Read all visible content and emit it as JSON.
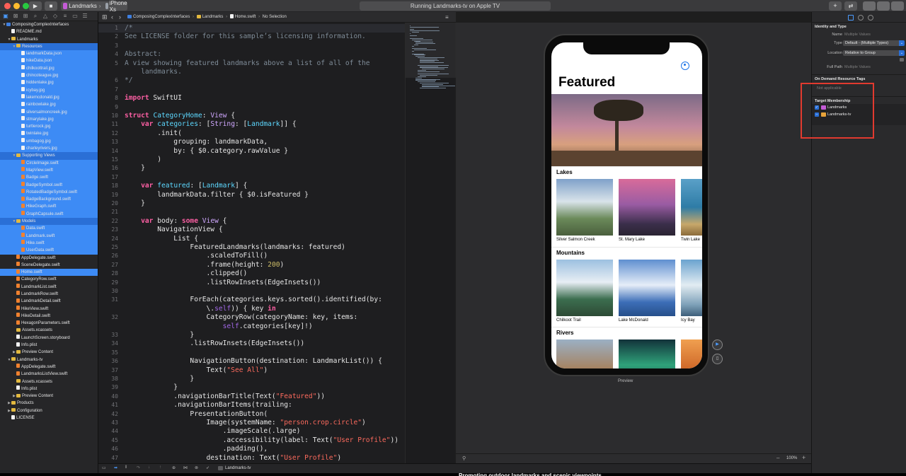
{
  "window": {
    "scheme_target": "Landmarks",
    "scheme_device": "iPhone Xs",
    "activity_status": "Running Landmarks-tv on Apple TV"
  },
  "navigator": {
    "rows": [
      {
        "label": "ComposingComplexInterfaces",
        "indent": 0,
        "kind": "proj",
        "disclosure": "▼",
        "state": "normal"
      },
      {
        "label": "README.md",
        "indent": 1,
        "kind": "file",
        "disclosure": "",
        "state": "normal"
      },
      {
        "label": "Landmarks",
        "indent": 1,
        "kind": "folder",
        "disclosure": "▼",
        "state": "normal"
      },
      {
        "label": "Resources",
        "indent": 2,
        "kind": "folder",
        "disclosure": "▼",
        "state": "sel"
      },
      {
        "label": "landmarkData.json",
        "indent": 3,
        "kind": "file",
        "disclosure": "",
        "state": "sel-light"
      },
      {
        "label": "hikeData.json",
        "indent": 3,
        "kind": "file",
        "disclosure": "",
        "state": "sel-light"
      },
      {
        "label": "chilkoottrail.jpg",
        "indent": 3,
        "kind": "file",
        "disclosure": "",
        "state": "sel-light"
      },
      {
        "label": "chincoteague.jpg",
        "indent": 3,
        "kind": "file",
        "disclosure": "",
        "state": "sel-light"
      },
      {
        "label": "hiddenlake.jpg",
        "indent": 3,
        "kind": "file",
        "disclosure": "",
        "state": "sel-light"
      },
      {
        "label": "icybay.jpg",
        "indent": 3,
        "kind": "file",
        "disclosure": "",
        "state": "sel-light"
      },
      {
        "label": "lakemcdonald.jpg",
        "indent": 3,
        "kind": "file",
        "disclosure": "",
        "state": "sel-light"
      },
      {
        "label": "rainbowlake.jpg",
        "indent": 3,
        "kind": "file",
        "disclosure": "",
        "state": "sel-light"
      },
      {
        "label": "silversalmoncreek.jpg",
        "indent": 3,
        "kind": "file",
        "disclosure": "",
        "state": "sel-light"
      },
      {
        "label": "stmarylake.jpg",
        "indent": 3,
        "kind": "file",
        "disclosure": "",
        "state": "sel-light"
      },
      {
        "label": "turtlerock.jpg",
        "indent": 3,
        "kind": "file",
        "disclosure": "",
        "state": "sel-light"
      },
      {
        "label": "twinlake.jpg",
        "indent": 3,
        "kind": "file",
        "disclosure": "",
        "state": "sel-light"
      },
      {
        "label": "umbagog.jpg",
        "indent": 3,
        "kind": "file",
        "disclosure": "",
        "state": "sel-light"
      },
      {
        "label": "charleyrivers.jpg",
        "indent": 3,
        "kind": "file",
        "disclosure": "",
        "state": "sel-light"
      },
      {
        "label": "Supporting Views",
        "indent": 2,
        "kind": "folder",
        "disclosure": "▼",
        "state": "sel"
      },
      {
        "label": "CircleImage.swift",
        "indent": 3,
        "kind": "swift",
        "disclosure": "",
        "state": "sel-light"
      },
      {
        "label": "MapView.swift",
        "indent": 3,
        "kind": "swift",
        "disclosure": "",
        "state": "sel-light"
      },
      {
        "label": "Badge.swift",
        "indent": 3,
        "kind": "swift",
        "disclosure": "",
        "state": "sel-light"
      },
      {
        "label": "BadgeSymbol.swift",
        "indent": 3,
        "kind": "swift",
        "disclosure": "",
        "state": "sel-light"
      },
      {
        "label": "RotatedBadgeSymbol.swift",
        "indent": 3,
        "kind": "swift",
        "disclosure": "",
        "state": "sel-light"
      },
      {
        "label": "BadgeBackground.swift",
        "indent": 3,
        "kind": "swift",
        "disclosure": "",
        "state": "sel-light"
      },
      {
        "label": "HikeGraph.swift",
        "indent": 3,
        "kind": "swift",
        "disclosure": "",
        "state": "sel-light"
      },
      {
        "label": "GraphCapsule.swift",
        "indent": 3,
        "kind": "swift",
        "disclosure": "",
        "state": "sel-light"
      },
      {
        "label": "Models",
        "indent": 2,
        "kind": "folder",
        "disclosure": "▼",
        "state": "sel"
      },
      {
        "label": "Data.swift",
        "indent": 3,
        "kind": "swift",
        "disclosure": "",
        "state": "sel-light"
      },
      {
        "label": "Landmark.swift",
        "indent": 3,
        "kind": "swift",
        "disclosure": "",
        "state": "sel-light"
      },
      {
        "label": "Hike.swift",
        "indent": 3,
        "kind": "swift",
        "disclosure": "",
        "state": "sel-light"
      },
      {
        "label": "UserData.swift",
        "indent": 3,
        "kind": "swift",
        "disclosure": "",
        "state": "sel-light"
      },
      {
        "label": "AppDelegate.swift",
        "indent": 2,
        "kind": "swift",
        "disclosure": "",
        "state": "normal"
      },
      {
        "label": "SceneDelegate.swift",
        "indent": 2,
        "kind": "swift",
        "disclosure": "",
        "state": "normal"
      },
      {
        "label": "Home.swift",
        "indent": 2,
        "kind": "swift",
        "disclosure": "",
        "state": "sel-light"
      },
      {
        "label": "CategoryRow.swift",
        "indent": 2,
        "kind": "swift",
        "disclosure": "",
        "state": "normal"
      },
      {
        "label": "LandmarkList.swift",
        "indent": 2,
        "kind": "swift",
        "disclosure": "",
        "state": "normal"
      },
      {
        "label": "LandmarkRow.swift",
        "indent": 2,
        "kind": "swift",
        "disclosure": "",
        "state": "normal"
      },
      {
        "label": "LandmarkDetail.swift",
        "indent": 2,
        "kind": "swift",
        "disclosure": "",
        "state": "normal"
      },
      {
        "label": "HikeView.swift",
        "indent": 2,
        "kind": "swift",
        "disclosure": "",
        "state": "normal"
      },
      {
        "label": "HikeDetail.swift",
        "indent": 2,
        "kind": "swift",
        "disclosure": "",
        "state": "normal"
      },
      {
        "label": "HexagonParameters.swift",
        "indent": 2,
        "kind": "swift",
        "disclosure": "",
        "state": "normal"
      },
      {
        "label": "Assets.xcassets",
        "indent": 2,
        "kind": "folder",
        "disclosure": "",
        "state": "normal"
      },
      {
        "label": "LaunchScreen.storyboard",
        "indent": 2,
        "kind": "file",
        "disclosure": "",
        "state": "normal"
      },
      {
        "label": "Info.plist",
        "indent": 2,
        "kind": "file",
        "disclosure": "",
        "state": "normal"
      },
      {
        "label": "Preview Content",
        "indent": 2,
        "kind": "folder",
        "disclosure": "▶",
        "state": "normal"
      },
      {
        "label": "Landmarks-tv",
        "indent": 1,
        "kind": "folder",
        "disclosure": "▼",
        "state": "normal"
      },
      {
        "label": "AppDelegate.swift",
        "indent": 2,
        "kind": "swift",
        "disclosure": "",
        "state": "normal"
      },
      {
        "label": "LandmarksListView.swift",
        "indent": 2,
        "kind": "swift",
        "disclosure": "",
        "state": "normal"
      },
      {
        "label": "Assets.xcassets",
        "indent": 2,
        "kind": "folder",
        "disclosure": "",
        "state": "normal"
      },
      {
        "label": "Info.plist",
        "indent": 2,
        "kind": "file",
        "disclosure": "",
        "state": "normal"
      },
      {
        "label": "Preview Content",
        "indent": 2,
        "kind": "folder",
        "disclosure": "▶",
        "state": "normal"
      },
      {
        "label": "Products",
        "indent": 1,
        "kind": "folder",
        "disclosure": "▶",
        "state": "normal"
      },
      {
        "label": "Configuration",
        "indent": 1,
        "kind": "folder",
        "disclosure": "▶",
        "state": "normal"
      },
      {
        "label": "LICENSE",
        "indent": 1,
        "kind": "file",
        "disclosure": "",
        "state": "normal"
      }
    ]
  },
  "jumpbar": {
    "project": "ComposingComplexInterfaces",
    "group": "Landmarks",
    "file": "Home.swift",
    "selection": "No Selection"
  },
  "editor": {
    "lines": [
      {
        "n": "1",
        "html": "<span class='cm'>/*</span>"
      },
      {
        "n": "2",
        "html": "<span class='cm'>See LICENSE folder for this sample’s licensing information.</span>"
      },
      {
        "n": "3",
        "html": ""
      },
      {
        "n": "4",
        "html": "<span class='cm'>Abstract:</span>"
      },
      {
        "n": "5",
        "html": "<span class='cm'>A view showing featured landmarks above a list of all of the</span>"
      },
      {
        "n": "",
        "html": "<span class='cm'>    landmarks.</span>"
      },
      {
        "n": "6",
        "html": "<span class='cm'>*/</span>"
      },
      {
        "n": "7",
        "html": ""
      },
      {
        "n": "8",
        "html": "<span class='kw'>import</span> SwiftUI"
      },
      {
        "n": "9",
        "html": ""
      },
      {
        "n": "10",
        "html": "<span class='kw'>struct</span> <span class='ty'>CategoryHome</span>: <span class='tyd'>View</span> {"
      },
      {
        "n": "11",
        "html": "    <span class='kw'>var</span> <span class='ty'>categories</span>: [<span class='tyd'>String</span>: [<span class='ty'>Landmark</span>]] {"
      },
      {
        "n": "12",
        "html": "        .init("
      },
      {
        "n": "13",
        "html": "            grouping: landmarkData,"
      },
      {
        "n": "14",
        "html": "            by: { $0.category.rawValue }"
      },
      {
        "n": "15",
        "html": "        )"
      },
      {
        "n": "16",
        "html": "    }"
      },
      {
        "n": "17",
        "html": ""
      },
      {
        "n": "18",
        "html": "    <span class='kw'>var</span> <span class='ty'>featured</span>: [<span class='ty'>Landmark</span>] {"
      },
      {
        "n": "19",
        "html": "        landmarkData.filter { $0.isFeatured }"
      },
      {
        "n": "20",
        "html": "    }"
      },
      {
        "n": "21",
        "html": ""
      },
      {
        "n": "22",
        "html": "    <span class='kw'>var</span> body: <span class='kw'>some</span> <span class='tyd'>View</span> {"
      },
      {
        "n": "23",
        "html": "        NavigationView {"
      },
      {
        "n": "24",
        "html": "            List {"
      },
      {
        "n": "25",
        "html": "                FeaturedLandmarks(landmarks: featured)"
      },
      {
        "n": "26",
        "html": "                    .scaledToFill()"
      },
      {
        "n": "27",
        "html": "                    .frame(height: <span class='nm'>200</span>)"
      },
      {
        "n": "28",
        "html": "                    .clipped()"
      },
      {
        "n": "29",
        "html": "                    .listRowInsets(EdgeInsets())"
      },
      {
        "n": "30",
        "html": ""
      },
      {
        "n": "31",
        "html": "                ForEach(categories.keys.sorted().identified(by:"
      },
      {
        "n": "",
        "html": "                    \\.<span class='pr'>self</span>)) { key <span class='kw'>in</span>"
      },
      {
        "n": "32",
        "html": "                    CategoryRow(categoryName: key, items:"
      },
      {
        "n": "",
        "html": "                        <span class='pr'>self</span>.categories[key]!)"
      },
      {
        "n": "33",
        "html": "                }"
      },
      {
        "n": "34",
        "html": "                .listRowInsets(EdgeInsets())"
      },
      {
        "n": "35",
        "html": ""
      },
      {
        "n": "36",
        "html": "                NavigationButton(destination: LandmarkList()) {"
      },
      {
        "n": "37",
        "html": "                    Text(<span class='st'>\"See All\"</span>)"
      },
      {
        "n": "38",
        "html": "                }"
      },
      {
        "n": "39",
        "html": "            }"
      },
      {
        "n": "40",
        "html": "            .navigationBarTitle(Text(<span class='st'>\"Featured\"</span>))"
      },
      {
        "n": "41",
        "html": "            .navigationBarItems(trailing:"
      },
      {
        "n": "42",
        "html": "                PresentationButton("
      },
      {
        "n": "43",
        "html": "                    Image(systemName: <span class='st'>\"person.crop.circle\"</span>)"
      },
      {
        "n": "44",
        "html": "                        .imageScale(.large)"
      },
      {
        "n": "45",
        "html": "                        .accessibility(label: Text(<span class='st'>\"User Profile\"</span>))"
      },
      {
        "n": "46",
        "html": "                        .padding(),"
      },
      {
        "n": "47",
        "html": "                    destination: Text(<span class='st'>\"User Profile\"</span>)"
      }
    ]
  },
  "preview": {
    "title": "Featured",
    "label": "Preview",
    "zoom": "100%",
    "sections": [
      {
        "title": "Lakes",
        "items": [
          "Silver Salmon Creek",
          "St. Mary Lake",
          "Twin Lake"
        ]
      },
      {
        "title": "Mountains",
        "items": [
          "Chilkoot Trail",
          "Lake McDonald",
          "Icy Bay"
        ]
      },
      {
        "title": "Rivers",
        "items": [
          "",
          "",
          ""
        ]
      }
    ]
  },
  "inspector": {
    "identity_heading": "Identity and Type",
    "name_label": "Name",
    "name_placeholder": "Multiple Values",
    "type_label": "Type",
    "type_value": "Default - (Multiple Types)",
    "location_label": "Location",
    "location_value": "Relative to Group",
    "fullpath_label": "Full Path",
    "fullpath_value": "Multiple Values",
    "odr_heading": "On Demand Resource Tags",
    "odr_value": "Not applicable",
    "membership_heading": "Target Membership",
    "targets": [
      {
        "name": "Landmarks",
        "state": "✓"
      },
      {
        "name": "Landmarks-tv",
        "state": "–"
      }
    ]
  },
  "debugbar": {
    "target": "Landmarks-tv"
  },
  "caption_fragment": "Promoting outdoor landmarks and scenic viewpoints"
}
